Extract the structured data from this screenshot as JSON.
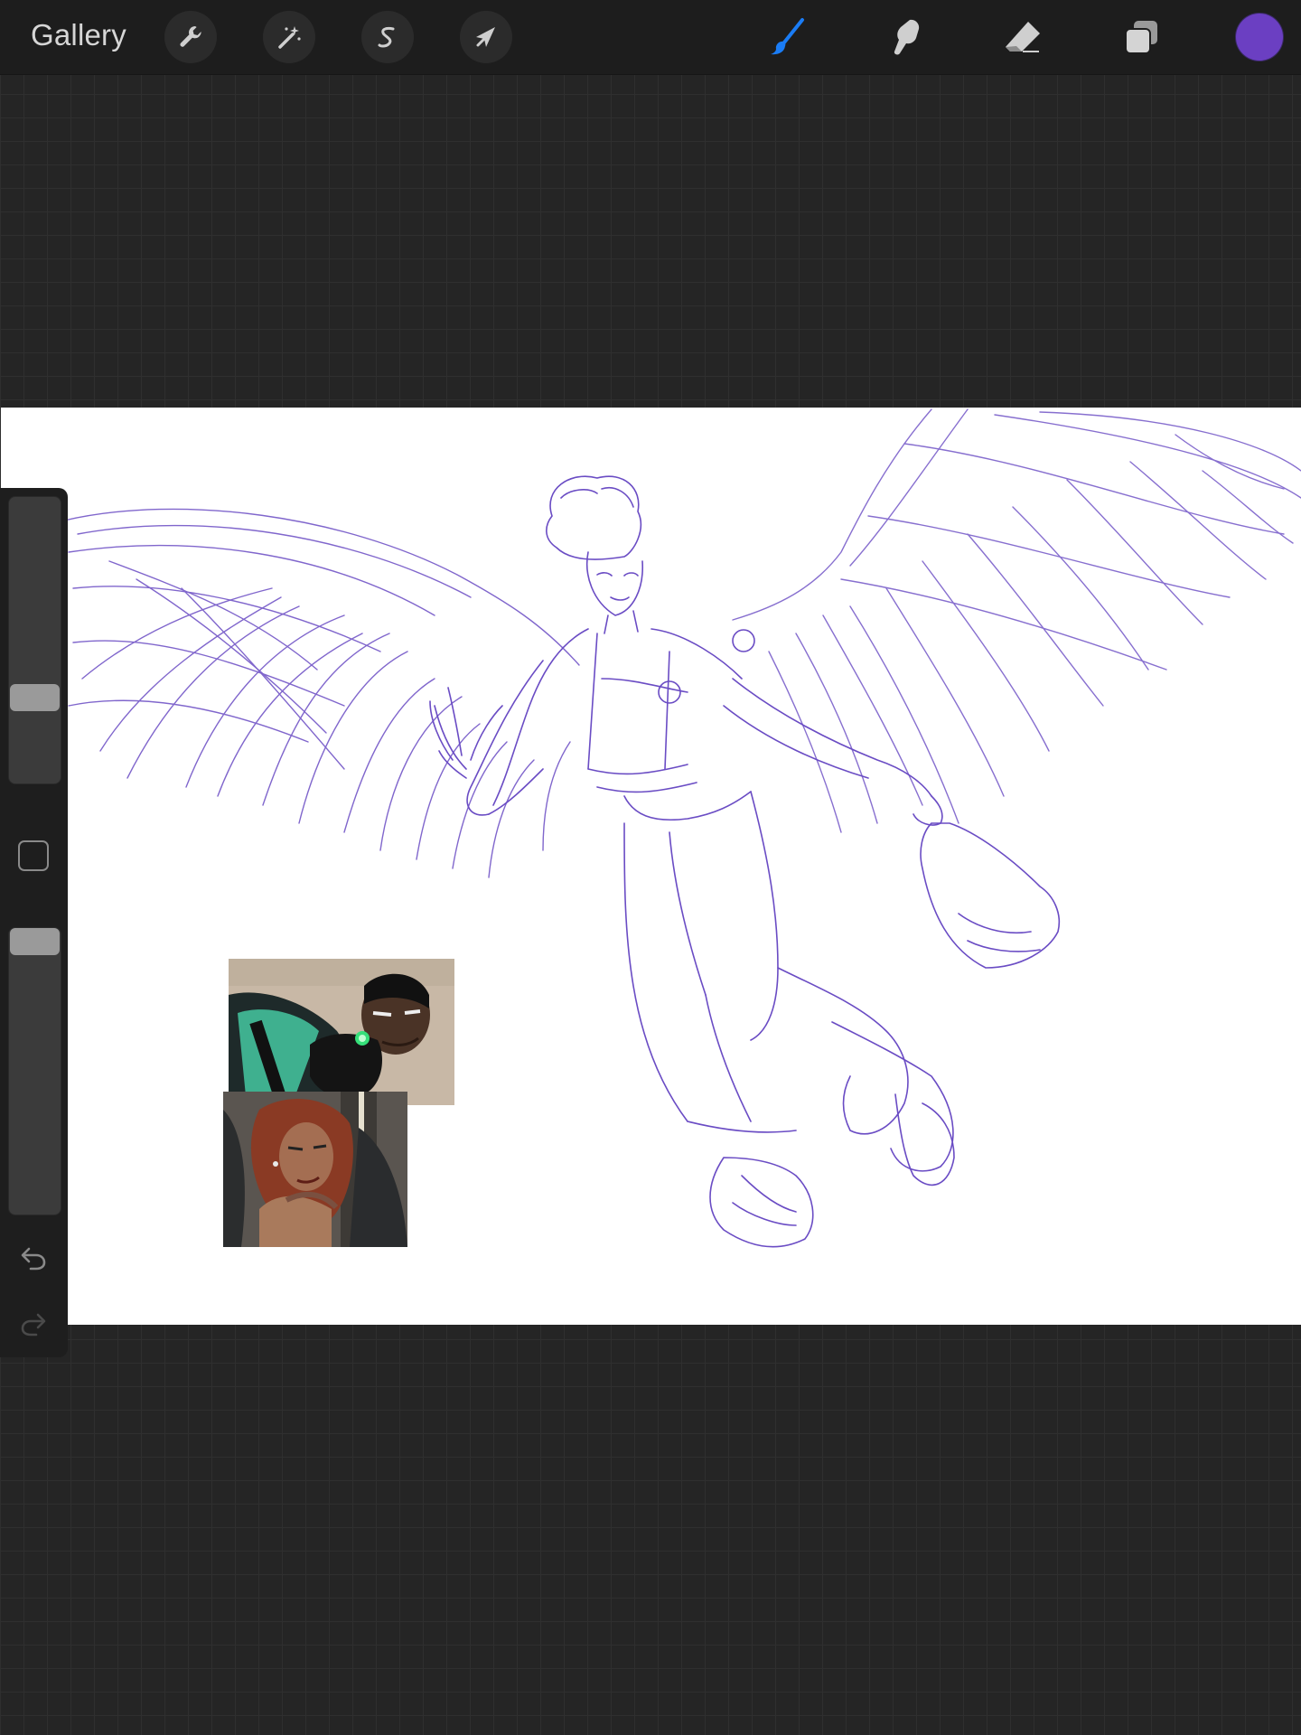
{
  "toolbar": {
    "gallery_label": "Gallery",
    "left_tools": [
      {
        "name": "actions",
        "icon": "wrench-icon"
      },
      {
        "name": "adjustments",
        "icon": "magic-wand-icon"
      },
      {
        "name": "selection",
        "icon": "selection-s-icon"
      },
      {
        "name": "transform",
        "icon": "arrow-cursor-icon"
      }
    ],
    "right_tools": [
      {
        "name": "brush",
        "icon": "brush-icon",
        "active": true
      },
      {
        "name": "smudge",
        "icon": "smudge-finger-icon",
        "active": false
      },
      {
        "name": "eraser",
        "icon": "eraser-icon",
        "active": false
      },
      {
        "name": "layers",
        "icon": "layers-icon",
        "active": false
      }
    ],
    "current_color": "#6b3fc2",
    "active_tool_color": "#1a7cf5"
  },
  "sidebar": {
    "brush_size_level": 0.28,
    "opacity_level": 1.0,
    "modify_icon": "square-icon",
    "undo_icon": "undo-arrow-icon",
    "redo_icon": "redo-arrow-icon"
  },
  "canvas": {
    "background": "#ffffff",
    "sketch_color": "#6a4cc4",
    "subject": "winged-figure-sketch",
    "references": [
      "reference-image-green-lantern",
      "reference-image-hawkgirl"
    ]
  }
}
